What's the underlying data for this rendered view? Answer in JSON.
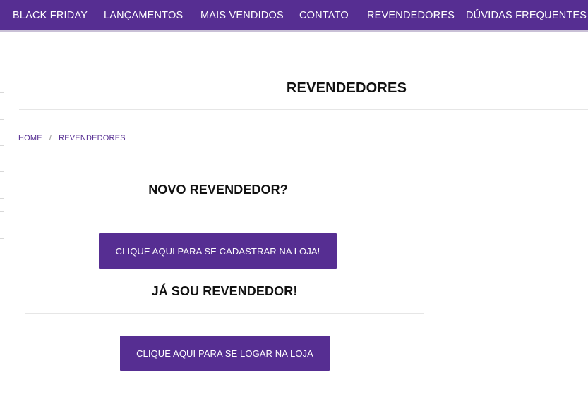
{
  "nav": {
    "items": [
      {
        "label": "BLACK FRIDAY"
      },
      {
        "label": "LANÇAMENTOS"
      },
      {
        "label": "MAIS VENDIDOS"
      },
      {
        "label": "CONTATO"
      },
      {
        "label": "REVENDEDORES"
      },
      {
        "label": "DÚVIDAS FREQUENTES"
      }
    ]
  },
  "page": {
    "title": "REVENDEDORES"
  },
  "breadcrumb": {
    "home": "HOME",
    "separator": "/",
    "current": "REVENDEDORES"
  },
  "new_reseller": {
    "heading": "NOVO REVENDEDOR?",
    "button_label": "CLIQUE AQUI PARA SE CADASTRAR NA LOJA!"
  },
  "existing_reseller": {
    "heading": "JÁ SOU REVENDEDOR!",
    "button_label": "CLIQUE AQUI PARA SE LOGAR NA LOJA"
  },
  "colors": {
    "brand_purple": "#562e92"
  }
}
